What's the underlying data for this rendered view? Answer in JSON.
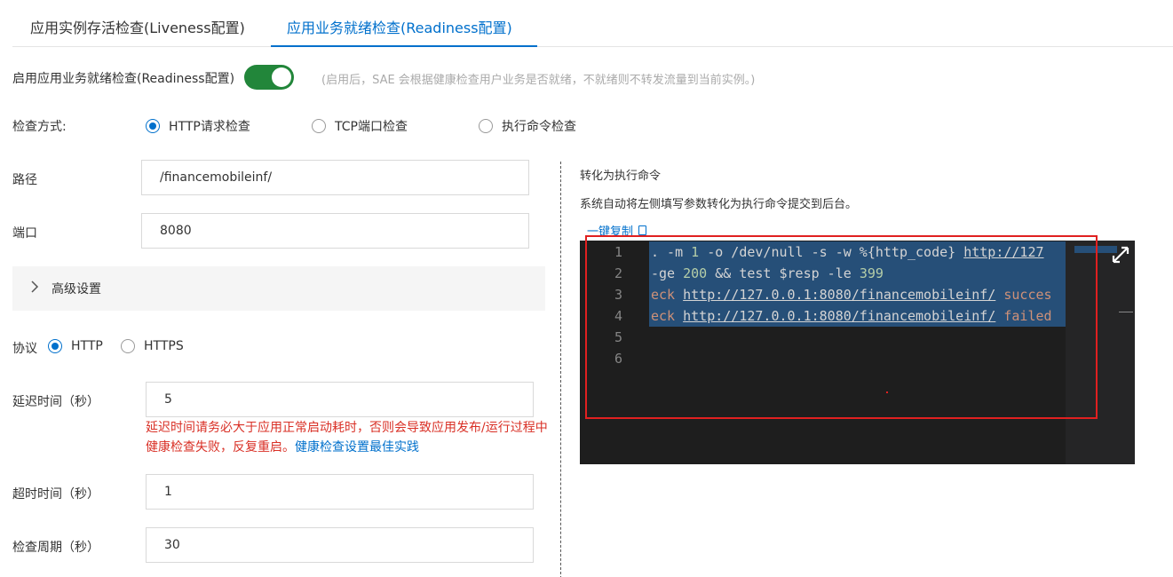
{
  "tabs": [
    {
      "label": "应用实例存活检查(Liveness配置)",
      "active": false
    },
    {
      "label": "应用业务就绪检查(Readiness配置)",
      "active": true
    }
  ],
  "enable": {
    "label": "启用应用业务就绪检查(Readiness配置)",
    "on": true,
    "hint": "(启用后，SAE 会根据健康检查用户业务是否就绪，不就绪则不转发流量到当前实例。)"
  },
  "method": {
    "label": "检查方式:",
    "options": [
      "HTTP请求检查",
      "TCP端口检查",
      "执行命令检查"
    ],
    "selected": "HTTP请求检查"
  },
  "path": {
    "label": "路径",
    "value": "/financemobileinf/"
  },
  "port": {
    "label": "端口",
    "value": "8080"
  },
  "advanced": {
    "label": "高级设置"
  },
  "protocol": {
    "label": "协议",
    "options": [
      "HTTP",
      "HTTPS"
    ],
    "selected": "HTTP"
  },
  "delay": {
    "label": "延迟时间（秒）",
    "value": "5",
    "warning": "延迟时间请务必大于应用正常启动耗时，否则会导致应用发布/运行过程中健康检查失败，反复重启。",
    "link": "健康检查设置最佳实践"
  },
  "timeout": {
    "label": "超时时间（秒）",
    "value": "1"
  },
  "period": {
    "label": "检查周期（秒）",
    "value": "30"
  },
  "convert": {
    "title": "转化为执行命令",
    "desc": "系统自动将左侧填写参数转化为执行命令提交到后台。",
    "copy_label": "一键复制"
  },
  "editor": {
    "line_numbers": [
      "1",
      "2",
      "3",
      "4",
      "5",
      "6"
    ],
    "lines": [
      {
        "parts": [
          [
            "",
            ". -m "
          ],
          [
            "num",
            "1"
          ],
          [
            "",
            " -o /dev/null -s -w %{http_code} "
          ],
          [
            "url",
            "http://127"
          ]
        ]
      },
      {
        "parts": [
          [
            "",
            "-ge "
          ],
          [
            "num",
            "200"
          ],
          [
            "",
            " && test $resp -le "
          ],
          [
            "num",
            "399"
          ]
        ]
      },
      {
        "parts": [
          [
            "kw",
            "eck "
          ],
          [
            "url",
            "http://127.0.0.1:8080/financemobileinf/"
          ],
          [
            "kw",
            " succes"
          ]
        ]
      },
      {
        "parts": [
          [
            "kw",
            "eck "
          ],
          [
            "url",
            "http://127.0.0.1:8080/financemobileinf/"
          ],
          [
            "kw",
            " failed"
          ]
        ]
      },
      {
        "parts": []
      },
      {
        "parts": []
      }
    ]
  },
  "colors": {
    "accent": "#0070cc",
    "switch_on": "#22863a",
    "warning": "#d93026",
    "highlight_box": "#e02020"
  }
}
